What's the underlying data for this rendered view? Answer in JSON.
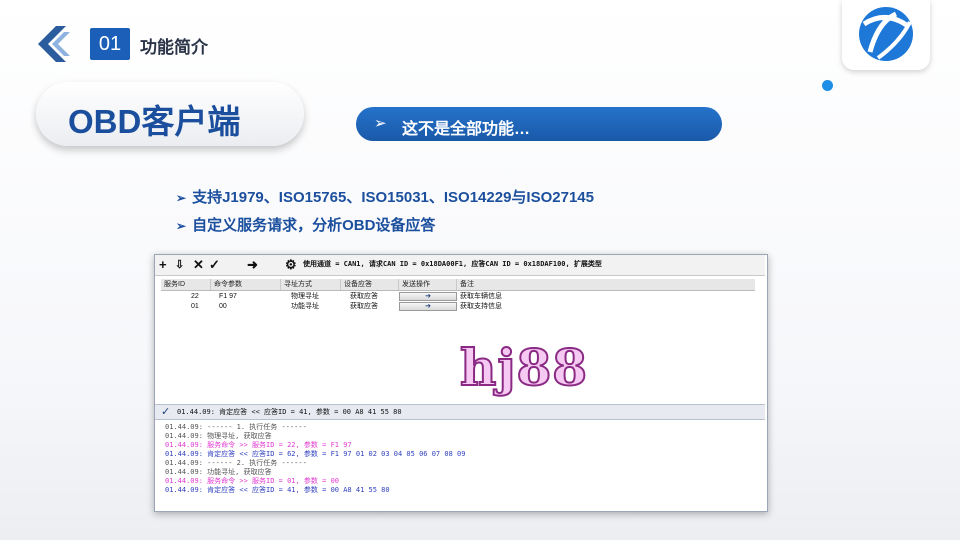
{
  "header": {
    "section_number": "01",
    "section_title": "功能简介",
    "slide_title": "OBD客户端",
    "banner_arrow": "➢",
    "banner_text": "这不是全部功能…"
  },
  "bullets": [
    {
      "marker": "➢",
      "text": "支持J1979、ISO15765、ISO15031、ISO14229与ISO27145"
    },
    {
      "marker": "➢",
      "text": "自定义服务请求，分析OBD设备应答"
    }
  ],
  "app": {
    "status": "使用通道 = CAN1, 请求CAN ID = 0x18DA00F1, 应答CAN ID = 0x18DAF100, 扩展类型",
    "columns": [
      "服务ID",
      "命令参数",
      "寻址方式",
      "设备应答",
      "发送操作",
      "备注"
    ],
    "rows": [
      {
        "sid": "22",
        "param": "F1 97",
        "addr": "物理寻址",
        "resp": "获取应答",
        "send": "➔",
        "note": "获取车辆信息"
      },
      {
        "sid": "01",
        "param": "00",
        "addr": "功能寻址",
        "resp": "获取应答",
        "send": "➔",
        "note": "获取支持信息"
      }
    ],
    "split_status": "01.44.09: 肯定应答 << 应答ID = 41, 参数 = 00 A8 41 55 80",
    "log": [
      {
        "text": "01.44.09: ------ 1. 执行任务 ------",
        "color": "#555555"
      },
      {
        "text": "01.44.09: 物理寻址, 获取应答",
        "color": "#555555"
      },
      {
        "text": "01.44.09: 服务命令 >> 服务ID = 22, 参数 = F1 97",
        "color": "#e23ad1"
      },
      {
        "text": "01.44.09: 肯定应答 << 应答ID = 62, 参数 = F1 97 01 02 03 04 05 06 07 08 09",
        "color": "#2f3fbf"
      },
      {
        "text": "01.44.09: ------ 2. 执行任务 ------",
        "color": "#555555"
      },
      {
        "text": "01.44.09: 功能寻址, 获取应答",
        "color": "#555555"
      },
      {
        "text": "01.44.09: 服务命令 >> 服务ID = 01, 参数 = 00",
        "color": "#e23ad1"
      },
      {
        "text": "01.44.09: 肯定应答 << 应答ID = 41, 参数 = 00 A8 41 55 80",
        "color": "#2f3fbf"
      }
    ]
  },
  "watermark": "hj88",
  "colors": {
    "accent": "#1c5fb8",
    "title": "#1b4f9e",
    "banner": "#1e64b8",
    "request": "#e23ad1",
    "response": "#2f3fbf"
  }
}
